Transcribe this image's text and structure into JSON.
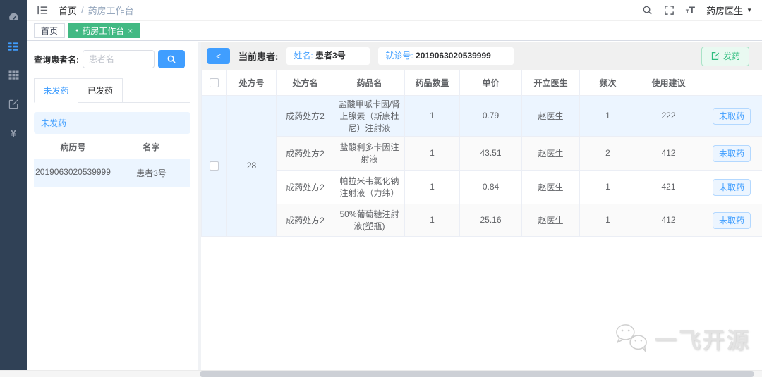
{
  "topbar": {
    "breadcrumb_home": "首页",
    "breadcrumb_sep": "/",
    "breadcrumb_current": "药房工作台",
    "user_name": "药房医生"
  },
  "tabbar": {
    "tabs": [
      {
        "label": "首页",
        "active": false
      },
      {
        "label": "药房工作台",
        "active": true
      }
    ]
  },
  "sidebar": {
    "icon_names": [
      "dashboard",
      "menu-list",
      "table",
      "edit",
      "currency-yuan"
    ]
  },
  "left_panel": {
    "search_label": "查询患者名:",
    "search_placeholder": "患者名",
    "tab_undispensed": "未发药",
    "tab_dispensed": "已发药",
    "banner_text": "未发药",
    "col_record_no": "病历号",
    "col_name": "名字",
    "patients": [
      {
        "record_no": "2019063020539999",
        "name": "患者3号"
      }
    ]
  },
  "main": {
    "current_patient_label": "当前患者:",
    "name_label": "姓名:",
    "name_value": "患者3号",
    "visit_label": "就诊号:",
    "visit_value": "2019063020539999",
    "dispense_label": "发药",
    "table": {
      "headers": [
        "处方号",
        "处方名",
        "药品名",
        "药品数量",
        "单价",
        "开立医生",
        "频次",
        "使用建议"
      ],
      "prescription_no": "28",
      "rows": [
        {
          "name": "成药处方2",
          "drug": "盐酸甲哌卡因/肾上腺素（斯康杜尼）注射液",
          "qty": "1",
          "price": "0.79",
          "doctor": "赵医生",
          "freq": "1",
          "advice": "222",
          "action": "未取药"
        },
        {
          "name": "成药处方2",
          "drug": "盐酸利多卡因注射液",
          "qty": "1",
          "price": "43.51",
          "doctor": "赵医生",
          "freq": "2",
          "advice": "412",
          "action": "未取药"
        },
        {
          "name": "成药处方2",
          "drug": "帕拉米韦氯化钠注射液（力纬）",
          "qty": "1",
          "price": "0.84",
          "doctor": "赵医生",
          "freq": "1",
          "advice": "421",
          "action": "未取药"
        },
        {
          "name": "成药处方2",
          "drug": "50%葡萄糖注射液(塑瓶)",
          "qty": "1",
          "price": "25.16",
          "doctor": "赵医生",
          "freq": "1",
          "advice": "412",
          "action": "未取药"
        }
      ]
    }
  },
  "watermark": {
    "text": "一飞开源"
  },
  "icons": {
    "dot": "●",
    "close": "×",
    "caret": "▼",
    "collapse": "<",
    "yuan": "¥",
    "fontsize_small": "т",
    "fontsize_large": "T"
  },
  "colors": {
    "primary": "#409eff",
    "sidebar_bg": "#304156",
    "tag_active_green": "#42b983",
    "row_highlight": "#ecf5ff",
    "success_green": "#2fbd7f"
  }
}
